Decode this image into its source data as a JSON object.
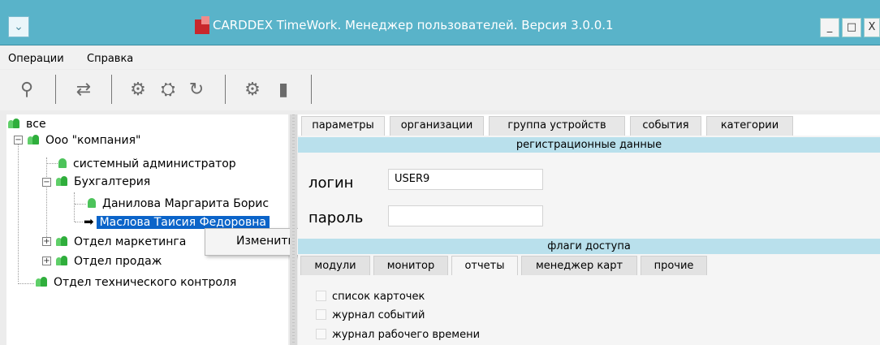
{
  "window": {
    "title": "CARDDEX TimeWork. Менеджер пользователей. Версия 3.0.0.1",
    "sysmenu_glyph": "⌄",
    "btn_min": "_",
    "btn_max": "□",
    "btn_close": "X"
  },
  "menubar": {
    "items": [
      "Операции",
      "Справка"
    ]
  },
  "toolbar": {
    "icons": [
      "search-icon",
      "transfer-icon",
      "settings-icon",
      "device-settings-icon",
      "refresh-icon",
      "user-settings-icon",
      "door-icon"
    ],
    "glyphs": [
      "⚲",
      "⇄",
      "⚙",
      "⛭",
      "↻",
      "⚙",
      "▮"
    ]
  },
  "tree": {
    "root_label": "все",
    "company_label": "Ооо \"компания\"",
    "admin_label": "системный администратор",
    "dept_accounting": "Бухгалтерия",
    "person_1": "Данилова Маргарита Борис",
    "person_2": "Маслова Таисия Федоровна",
    "dept_marketing": "Отдел маркетинга",
    "dept_sales": "Отдел продаж",
    "dept_tech": "Отдел технического контроля",
    "expander_minus": "−",
    "expander_plus": "+"
  },
  "context_menu": {
    "edit": "Изменить"
  },
  "tabs": [
    "параметры",
    "организации",
    "группа устройств",
    "события",
    "категории"
  ],
  "registration": {
    "header": "регистрационные данные",
    "login_label": "логин",
    "login_value": "USER9",
    "password_label": "пароль",
    "password_value": ""
  },
  "access": {
    "header": "флаги доступа",
    "subtabs": [
      "модули",
      "монитор",
      "отчеты",
      "менеджер карт",
      "прочие"
    ],
    "active_subtab": "отчеты",
    "checkboxes": [
      "список карточек",
      "журнал событий",
      "журнал рабочего времени"
    ]
  },
  "colors": {
    "titlebar": "#59b3c9",
    "section_bar": "#b9e0ec",
    "selection": "#0b64c9",
    "user_icon": "#2fae3c"
  }
}
